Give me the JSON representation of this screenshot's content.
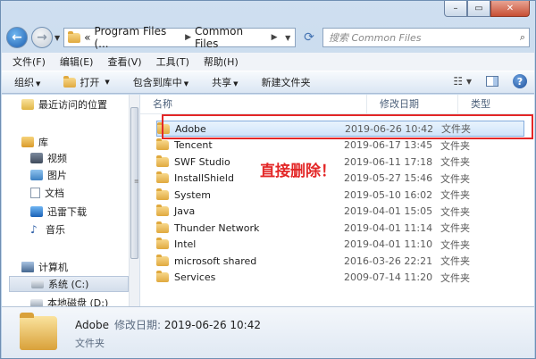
{
  "nav": {
    "path": [
      "Program Files (...",
      "Common Files"
    ],
    "path_prefix": "«",
    "search_placeholder": "搜索 Common Files"
  },
  "menu": [
    "文件(F)",
    "编辑(E)",
    "查看(V)",
    "工具(T)",
    "帮助(H)"
  ],
  "commands": {
    "organize": "组织",
    "open": "打开",
    "include": "包含到库中",
    "share": "共享",
    "new_folder": "新建文件夹"
  },
  "sidebar": {
    "items": [
      {
        "label": "最近访问的位置",
        "icon": "recent-places-icon"
      },
      {
        "label": "库",
        "icon": "library-icon"
      },
      {
        "label": "视频",
        "icon": "video-icon"
      },
      {
        "label": "图片",
        "icon": "pictures-icon"
      },
      {
        "label": "文档",
        "icon": "documents-icon"
      },
      {
        "label": "迅雷下载",
        "icon": "download-icon"
      },
      {
        "label": "音乐",
        "icon": "music-icon"
      },
      {
        "label": "计算机",
        "icon": "computer-icon"
      },
      {
        "label": "系统 (C:)",
        "icon": "drive-icon"
      },
      {
        "label": "本地磁盘 (D:)",
        "icon": "drive-icon"
      }
    ]
  },
  "columns": {
    "name": "名称",
    "date": "修改日期",
    "type": "类型"
  },
  "files": [
    {
      "name": "Adobe",
      "date": "2019-06-26 10:42",
      "type": "文件夹"
    },
    {
      "name": "Tencent",
      "date": "2019-06-17 13:45",
      "type": "文件夹"
    },
    {
      "name": "SWF Studio",
      "date": "2019-06-11 17:18",
      "type": "文件夹"
    },
    {
      "name": "InstallShield",
      "date": "2019-05-27 15:46",
      "type": "文件夹"
    },
    {
      "name": "System",
      "date": "2019-05-10 16:02",
      "type": "文件夹"
    },
    {
      "name": "Java",
      "date": "2019-04-01 15:05",
      "type": "文件夹"
    },
    {
      "name": "Thunder Network",
      "date": "2019-04-01 11:14",
      "type": "文件夹"
    },
    {
      "name": "Intel",
      "date": "2019-04-01 11:10",
      "type": "文件夹"
    },
    {
      "name": "microsoft shared",
      "date": "2016-03-26 22:21",
      "type": "文件夹"
    },
    {
      "name": "Services",
      "date": "2009-07-14 11:20",
      "type": "文件夹"
    }
  ],
  "annotation": "直接删除！",
  "details": {
    "name": "Adobe",
    "date_label": "修改日期:",
    "date": "2019-06-26 10:42",
    "type": "文件夹"
  },
  "colors": {
    "highlight": "#e32727",
    "annotation": "#e32727"
  }
}
